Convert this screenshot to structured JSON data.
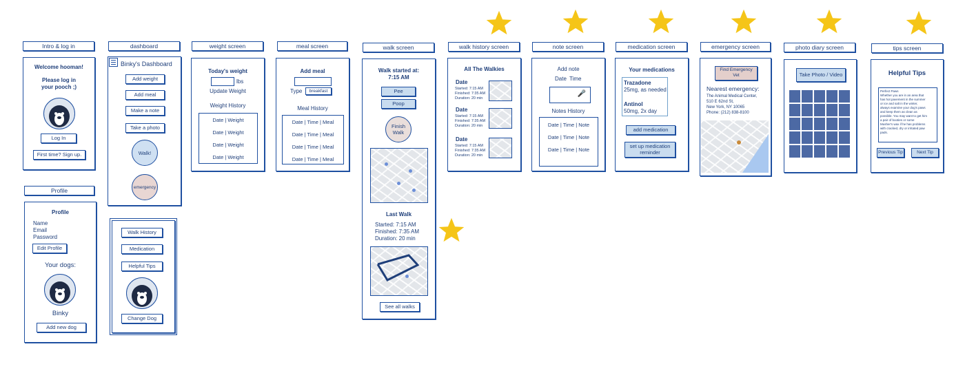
{
  "screens": {
    "intro": {
      "label": "Intro & log in",
      "welcome": "Welcome hooman!",
      "please1": "Please log in",
      "please2": "your pooch ;)",
      "login": "Log In",
      "signup": "First time? Sign up."
    },
    "profile": {
      "label": "Profile",
      "title": "Profile",
      "name": "Name",
      "email": "Email",
      "password": "Password",
      "edit": "Edit Profile",
      "dogs": "Your dogs:",
      "dog_name": "Binky",
      "add": "Add new dog"
    },
    "dashboard": {
      "label": "dashboard",
      "title": "Binky's Dashboard",
      "add_weight": "Add weight",
      "add_meal": "Add meal",
      "make_note": "Make a note",
      "take_photo": "Take a photo",
      "walk": "Walk!",
      "emergency": "emergency"
    },
    "menu": {
      "walk_history": "Walk History",
      "medication": "Medication",
      "tips": "Helpful Tips",
      "change_dog": "Change Dog"
    },
    "weight": {
      "label": "weight screen",
      "title": "Today's weight",
      "unit": "lbs",
      "update": "Update Weight",
      "history": "Weight History",
      "rows": [
        "Date  |  Weight",
        "Date  |  Weight",
        "Date  |  Weight",
        "Date  |  Weight"
      ]
    },
    "meal": {
      "label": "meal screen",
      "title": "Add meal",
      "type": "Type",
      "type_value": "breakfast",
      "history": "Meal History",
      "rows": [
        "Date | Time | Meal",
        "Date | Time | Meal",
        "Date | Time | Meal",
        "Date | Time | Meal"
      ]
    },
    "walk": {
      "label": "walk screen",
      "started1": "Walk started at:",
      "started2": "7:15 AM",
      "pee": "Pee",
      "poop": "Poop",
      "finish": "Finish Walk",
      "last": "Last Walk",
      "l1": "Started: 7:15 AM",
      "l2": "Finished: 7:35 AM",
      "l3": "Duration: 20 min",
      "see_all": "See all walks"
    },
    "walk_history": {
      "label": "walk history screen",
      "title": "All The Walkies",
      "entries": [
        {
          "date": "Date",
          "s": "Started: 7:15 AM",
          "f": "Finished: 7:35 AM",
          "d": "Duration: 20 min"
        },
        {
          "date": "Date",
          "s": "Started: 7:15 AM",
          "f": "Finished: 7:35 AM",
          "d": "Duration: 20 min"
        },
        {
          "date": "Date",
          "s": "Started: 7:15 AM",
          "f": "Finished: 7:35 AM",
          "d": "Duration: 20 min"
        }
      ]
    },
    "note": {
      "label": "note screen",
      "title": "Add note",
      "date": "Date",
      "time": "Time",
      "history": "Notes History",
      "rows": [
        "Date | Time | Note",
        "Date | Time | Note",
        "Date | Time | Note"
      ]
    },
    "medication": {
      "label": "medication screen",
      "title": "Your medications",
      "med1": "Trazadone",
      "med1_dose": "25mg, as needed",
      "med2": "Antinol",
      "med2_dose": "50mg, 2x day",
      "add": "add medication",
      "reminder1": "set up medication",
      "reminder2": "reminder"
    },
    "emergency": {
      "label": "emergency screen",
      "find1": "Find Emergency",
      "find2": "Vet",
      "nearest": "Nearest emergency:",
      "addr1": "The Animal Medical Center,",
      "addr2": "510 E 62nd St,",
      "addr3": "New York, NY 10065",
      "phone": "Phone: (212) 838-8100"
    },
    "photo": {
      "label": "photo diary screen",
      "take": "Take Photo / Video"
    },
    "tips": {
      "label": "tips screen",
      "title": "Helpful Tips",
      "text": [
        "Perfect Paws",
        "Whether you are in an area that",
        "has hot pavement in the summer",
        "or ice and salt in the winter,",
        "always examine your dog's paws",
        "and keep them as clean as",
        "possible. You may want to get him",
        "a pair of booties or some",
        "Musher's wax if he has problems",
        "with cracked, dry or irritated paw",
        "pads."
      ],
      "prev": "Previous Tip",
      "next": "Next Tip"
    }
  }
}
